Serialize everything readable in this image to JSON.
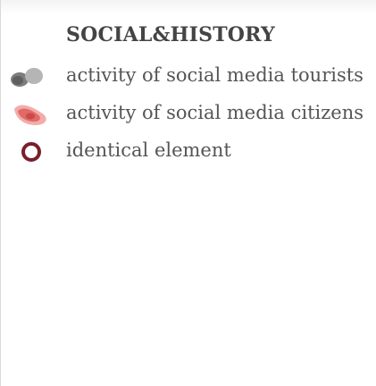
{
  "legend": {
    "title": "SOCIAL&HISTORY",
    "items": [
      {
        "label": "activity of social media tourists",
        "icon": "gray-blob-pair-icon",
        "color": "#8c8c8c"
      },
      {
        "label": "activity of social media citizens",
        "icon": "red-blob-icon",
        "color": "#d9534f"
      },
      {
        "label": "identical element",
        "icon": "ring-icon",
        "color": "#7a1f2b"
      }
    ]
  }
}
